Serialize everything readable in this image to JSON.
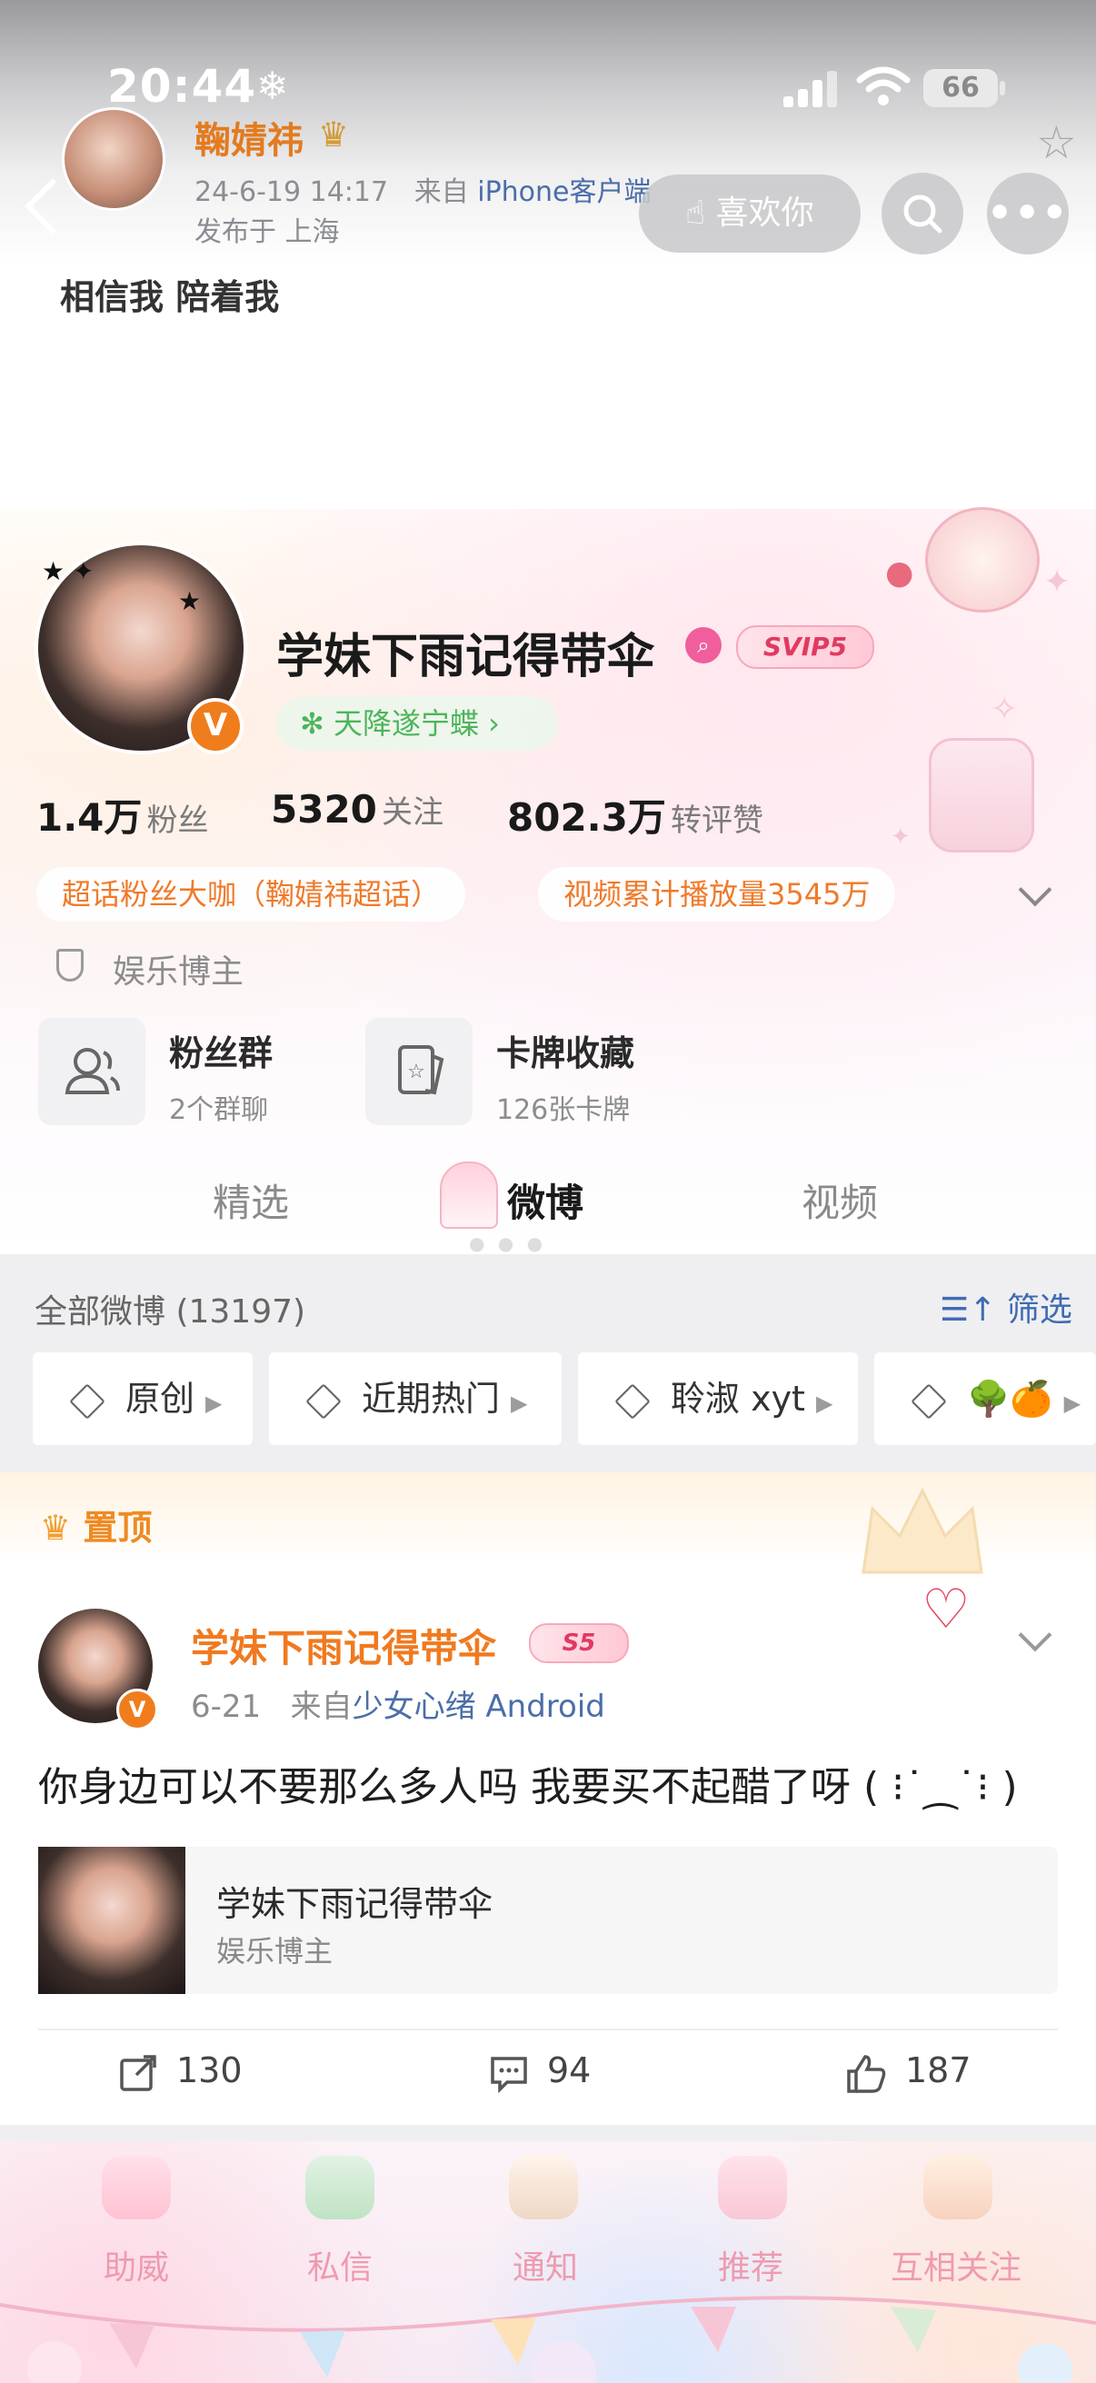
{
  "status": {
    "time": "20:44",
    "snow": "❄",
    "battery": "66"
  },
  "top": {
    "name": "鞠婧祎",
    "date": "24-6-19 14:17",
    "from_prefix": "来自",
    "from_device": "iPhone客户端",
    "location": "发布于 上海",
    "text": "相信我 陪着我",
    "like_button": "喜欢你"
  },
  "profile": {
    "name": "学妹下雨记得带伞",
    "svip": "SVIP5",
    "group_tag": "天降遂宁蝶 ›",
    "stats": [
      {
        "num": "1.4万",
        "label": "粉丝"
      },
      {
        "num": "5320",
        "label": "关注"
      },
      {
        "num": "802.3万",
        "label": "转评赞"
      }
    ],
    "pills": [
      "超话粉丝大咖（鞠婧祎超话）",
      "视频累计播放量3545万"
    ],
    "category": "娱乐博主",
    "cards": [
      {
        "title": "粉丝群",
        "sub": "2个群聊"
      },
      {
        "title": "卡牌收藏",
        "sub": "126张卡牌"
      }
    ],
    "tabs": [
      "精选",
      "微博",
      "视频"
    ]
  },
  "feed": {
    "all_weibo": "全部微博 (13197)",
    "filter": "筛选",
    "chips": [
      "原创",
      "近期热门",
      "聆淑 xyt",
      "🌳🍊"
    ],
    "pinned": "置顶"
  },
  "post": {
    "name": "学妹下雨记得带伞",
    "level": "S5",
    "date": "6-21",
    "from_prefix": "来自",
    "from_device": "少女心绪 Android",
    "body": "你身边可以不要那么多人吗 我要买不起醋了呀 (  ⁝˙⁔˙⁝ )",
    "card_title": "学妹下雨记得带伞",
    "card_sub": "娱乐博主",
    "reposts": "130",
    "comments": "94",
    "likes": "187"
  },
  "tabbar": [
    "助威",
    "私信",
    "通知",
    "推荐",
    "互相关注"
  ],
  "colors": {
    "accent_orange": "#F07A20",
    "link_blue": "#4A6EA8",
    "filter_blue": "#3F6BB3",
    "tab_pink": "#EE9BB0"
  },
  "icons": {
    "like_button": "flame-hand-icon",
    "search": "search-icon",
    "more": "more-dots-icon",
    "star": "star-outline-icon",
    "repost": "repost-icon",
    "comment": "comment-icon",
    "like": "thumbs-up-icon"
  }
}
